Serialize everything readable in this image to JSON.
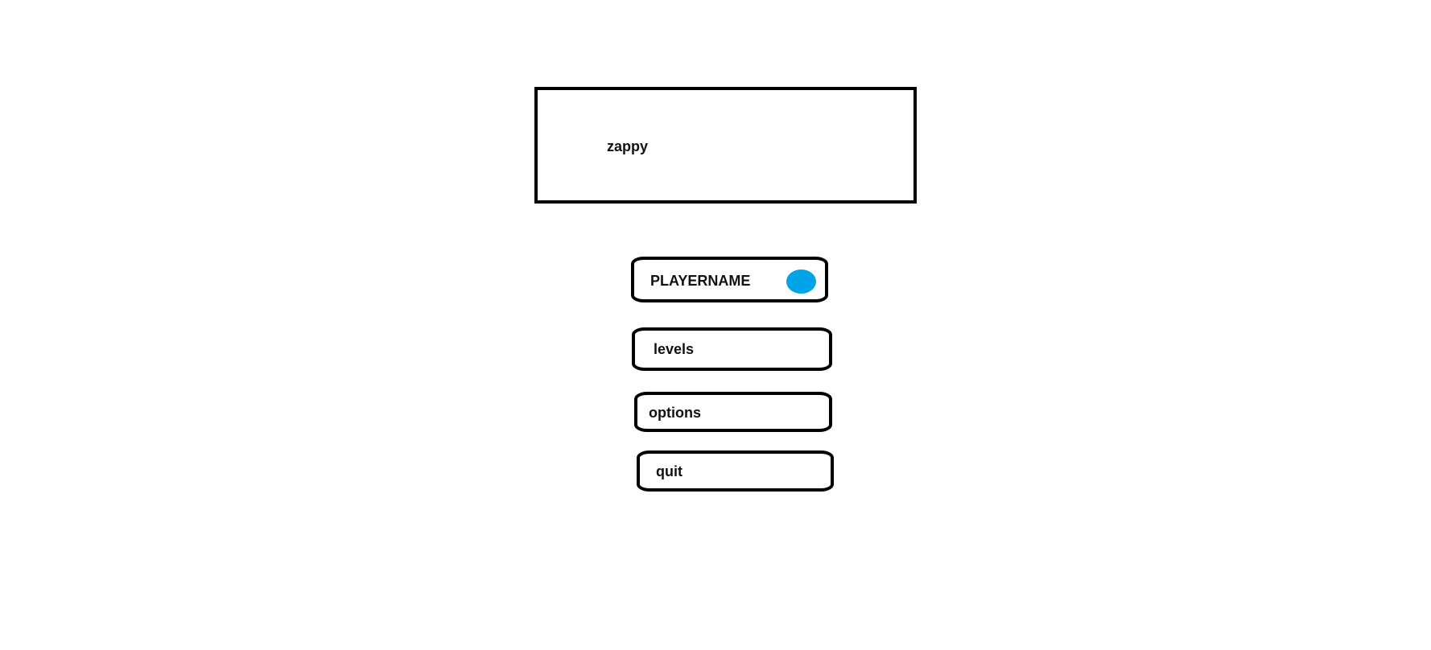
{
  "title": {
    "text": "zappy"
  },
  "menu": {
    "player": {
      "label": "PLAYERNAME",
      "indicator_color": "#00a2e8"
    },
    "levels": {
      "label": "levels"
    },
    "options": {
      "label": "options"
    },
    "quit": {
      "label": "quit"
    }
  }
}
